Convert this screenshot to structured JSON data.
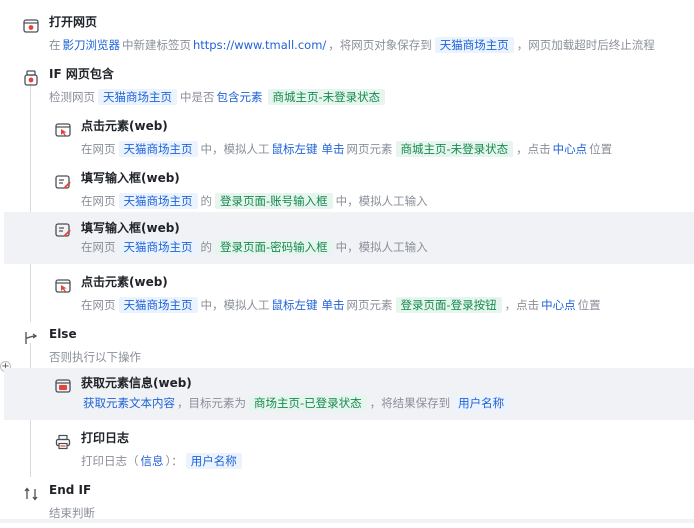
{
  "steps": [
    {
      "title": "打开网页",
      "desc": [
        {
          "k": "t",
          "v": "在"
        },
        {
          "k": "kw",
          "v": "影刀浏览器"
        },
        {
          "k": "t",
          "v": "中新建标签页"
        },
        {
          "k": "kw",
          "v": "https://www.tmall.com/"
        },
        {
          "k": "t",
          "v": "，将网页对象保存到"
        },
        {
          "k": "chip-blue",
          "v": "天猫商场主页"
        },
        {
          "k": "t",
          "v": "，网页加载超时后终止流程"
        }
      ]
    },
    {
      "title": "IF 网页包含",
      "desc": [
        {
          "k": "t",
          "v": "检测网页"
        },
        {
          "k": "chip-blue",
          "v": "天猫商场主页"
        },
        {
          "k": "t",
          "v": "中是否"
        },
        {
          "k": "kw",
          "v": "包含元素"
        },
        {
          "k": "chip-green",
          "v": "商城主页-未登录状态"
        }
      ]
    },
    {
      "title": "点击元素(web)",
      "desc": [
        {
          "k": "t",
          "v": "在网页"
        },
        {
          "k": "chip-blue",
          "v": "天猫商场主页"
        },
        {
          "k": "t",
          "v": "中，模拟人工"
        },
        {
          "k": "kw",
          "v": "鼠标左键"
        },
        {
          "k": "kw",
          "v": "单击"
        },
        {
          "k": "t",
          "v": "网页元素"
        },
        {
          "k": "chip-green",
          "v": "商城主页-未登录状态"
        },
        {
          "k": "t",
          "v": "，点击"
        },
        {
          "k": "kw",
          "v": "中心点"
        },
        {
          "k": "t",
          "v": "位置"
        }
      ]
    },
    {
      "title": "填写输入框(web)",
      "desc": [
        {
          "k": "t",
          "v": "在网页"
        },
        {
          "k": "chip-blue",
          "v": "天猫商场主页"
        },
        {
          "k": "t",
          "v": "的"
        },
        {
          "k": "chip-green",
          "v": "登录页面-账号输入框"
        },
        {
          "k": "t",
          "v": "中，模拟人工输入"
        }
      ]
    },
    {
      "title": "填写输入框(web)",
      "desc": [
        {
          "k": "t",
          "v": "在网页"
        },
        {
          "k": "chip-blue",
          "v": "天猫商场主页"
        },
        {
          "k": "t",
          "v": "的"
        },
        {
          "k": "chip-green",
          "v": "登录页面-密码输入框"
        },
        {
          "k": "t",
          "v": "中，模拟人工输入"
        }
      ]
    },
    {
      "title": "点击元素(web)",
      "desc": [
        {
          "k": "t",
          "v": "在网页"
        },
        {
          "k": "chip-blue",
          "v": "天猫商场主页"
        },
        {
          "k": "t",
          "v": "中，模拟人工"
        },
        {
          "k": "kw",
          "v": "鼠标左键"
        },
        {
          "k": "kw",
          "v": "单击"
        },
        {
          "k": "t",
          "v": "网页元素"
        },
        {
          "k": "chip-green",
          "v": "登录页面-登录按钮"
        },
        {
          "k": "t",
          "v": "，点击"
        },
        {
          "k": "kw",
          "v": "中心点"
        },
        {
          "k": "t",
          "v": "位置"
        }
      ]
    },
    {
      "title": "Else",
      "desc": [
        {
          "k": "t",
          "v": "否则执行以下操作"
        }
      ]
    },
    {
      "title": "获取元素信息(web)",
      "desc": [
        {
          "k": "kw",
          "v": "获取元素文本内容"
        },
        {
          "k": "t",
          "v": "，目标元素为"
        },
        {
          "k": "chip-green",
          "v": "商场主页-已登录状态"
        },
        {
          "k": "t",
          "v": "，将结果保存到"
        },
        {
          "k": "chip-blue",
          "v": "用户名称"
        }
      ]
    },
    {
      "title": "打印日志",
      "desc": [
        {
          "k": "t",
          "v": "打印日志（"
        },
        {
          "k": "kw",
          "v": "信息"
        },
        {
          "k": "t",
          "v": "）："
        },
        {
          "k": "chip-blue",
          "v": "用户名称"
        }
      ]
    },
    {
      "title": "End IF",
      "desc": [
        {
          "k": "t",
          "v": "结束判断"
        }
      ]
    }
  ],
  "colors": {
    "accent_blue": "#1e62d8",
    "chip_blue_bg": "#ebf3fe",
    "chip_green_text": "#16894f",
    "chip_green_bg": "#e6f6ee",
    "highlight_row_bg": "#f0f2f5",
    "icon_red": "#e0473a"
  },
  "icons": [
    "open-webpage-icon",
    "if-webpage-contains-icon",
    "click-element-icon",
    "fill-input-icon",
    "else-branch-icon",
    "get-element-info-icon",
    "print-log-icon",
    "end-if-icon"
  ]
}
